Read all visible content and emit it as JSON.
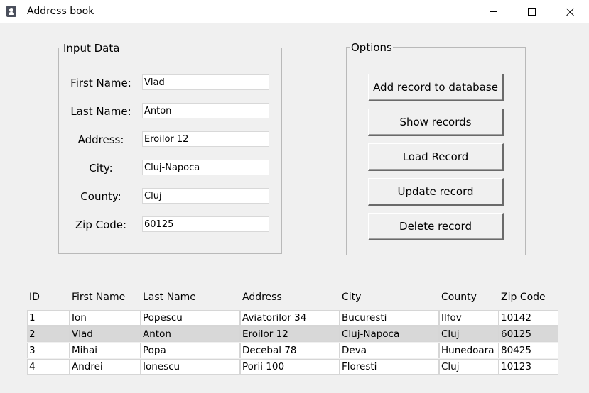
{
  "window": {
    "title": "Address book"
  },
  "input_frame": {
    "legend": "Input Data",
    "fields": [
      {
        "label": "First Name:",
        "value": "Vlad"
      },
      {
        "label": "Last Name:",
        "value": "Anton"
      },
      {
        "label": "Address:",
        "value": "Eroilor 12"
      },
      {
        "label": "City:",
        "value": "Cluj-Napoca"
      },
      {
        "label": "County:",
        "value": "Cluj"
      },
      {
        "label": "Zip Code:",
        "value": "60125"
      }
    ]
  },
  "options_frame": {
    "legend": "Options",
    "buttons": [
      "Add record to database",
      "Show records",
      "Load Record",
      "Update record",
      "Delete record"
    ]
  },
  "records_table": {
    "headers": [
      "ID",
      "First Name",
      "Last Name",
      "Address",
      "City",
      "County",
      "Zip Code"
    ],
    "rows": [
      [
        "1",
        "Ion",
        "Popescu",
        "Aviatorilor 34",
        "Bucuresti",
        "Ilfov",
        "10142"
      ],
      [
        "2",
        "Vlad",
        "Anton",
        "Eroilor 12",
        "Cluj-Napoca",
        "Cluj",
        "60125"
      ],
      [
        "3",
        "Mihai",
        "Popa",
        "Decebal 78",
        "Deva",
        "Hunedoara",
        "80425"
      ],
      [
        "4",
        "Andrei",
        "Ionescu",
        "Porii 100",
        "Floresti",
        "Cluj",
        "10123"
      ]
    ],
    "selected_row": 1
  }
}
